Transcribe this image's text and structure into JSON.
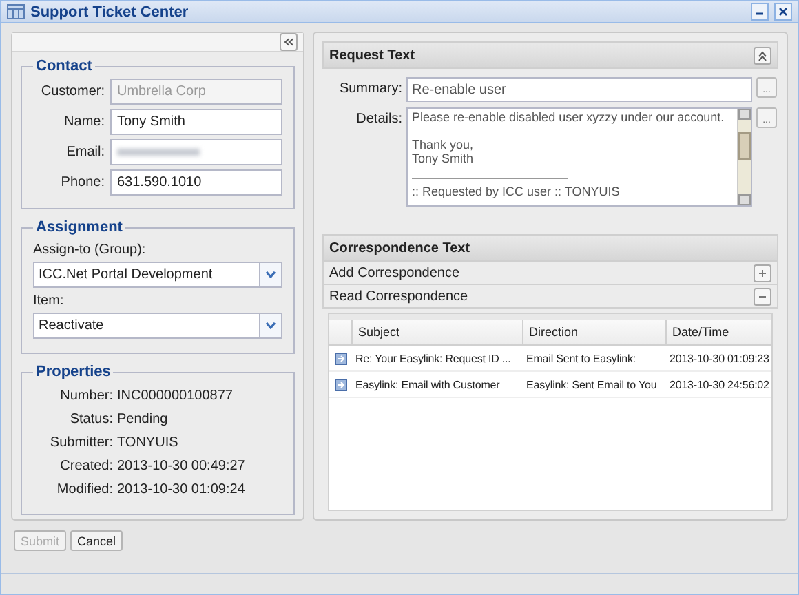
{
  "window": {
    "title": "Support Ticket Center"
  },
  "contact": {
    "legend": "Contact",
    "fields": [
      {
        "label": "Customer:",
        "value": "Umbrella Corp",
        "disabled": true,
        "blurred": false
      },
      {
        "label": "Name:",
        "value": "Tony Smith",
        "disabled": false,
        "blurred": false
      },
      {
        "label": "Email:",
        "disabled": false,
        "blurred": true
      },
      {
        "label": "Phone:",
        "value": "631.590.1010",
        "disabled": false,
        "blurred": false
      }
    ]
  },
  "assignment": {
    "legend": "Assignment",
    "fields": [
      {
        "label": "Assign-to (Group):",
        "value": "ICC.Net Portal Development"
      },
      {
        "label": "Item:",
        "value": "Reactivate"
      }
    ]
  },
  "properties": {
    "legend": "Properties",
    "rows": [
      {
        "label": "Number:",
        "value": "INC000000100877"
      },
      {
        "label": "Status:",
        "value": "Pending"
      },
      {
        "label": "Submitter:",
        "value": "TONYUIS"
      },
      {
        "label": "Created:",
        "value": "2013-10-30 00:49:27"
      },
      {
        "label": "Modified:",
        "value": "2013-10-30 01:09:24"
      }
    ]
  },
  "buttons": [
    {
      "label": "Submit",
      "disabled": true
    },
    {
      "label": "Cancel",
      "disabled": false
    }
  ],
  "request": {
    "title": "Request Text",
    "summary_label": "Summary:",
    "summary": "Re-enable user",
    "summary_button": "...",
    "details_button": "...",
    "details_label": "Details:",
    "details": [
      {
        "kind": "text",
        "text": "Please re-enable disabled user xyzzy under our account."
      },
      {
        "kind": "blank"
      },
      {
        "kind": "text",
        "text": "Thank you,"
      },
      {
        "kind": "text",
        "text": "Tony Smith"
      },
      {
        "kind": "rule"
      },
      {
        "kind": "text",
        "text": ":: Requested by ICC user :: TONYUIS"
      }
    ]
  },
  "correspondence": {
    "title": "Correspondence Text",
    "sections": [
      {
        "label": "Add Correspondence",
        "expanded": false
      },
      {
        "label": "Read Correspondence",
        "expanded": true
      }
    ],
    "columns": [
      "Subject",
      "Direction",
      "Date/Time"
    ],
    "rows": [
      [
        "Re: Your Easylink: Request ID ...",
        "Email Sent to Easylink:",
        "2013-10-30 01:09:23"
      ],
      [
        "Easylink: Email with Customer",
        "Easylink: Sent Email to You",
        "2013-10-30 24:56:02"
      ]
    ]
  }
}
